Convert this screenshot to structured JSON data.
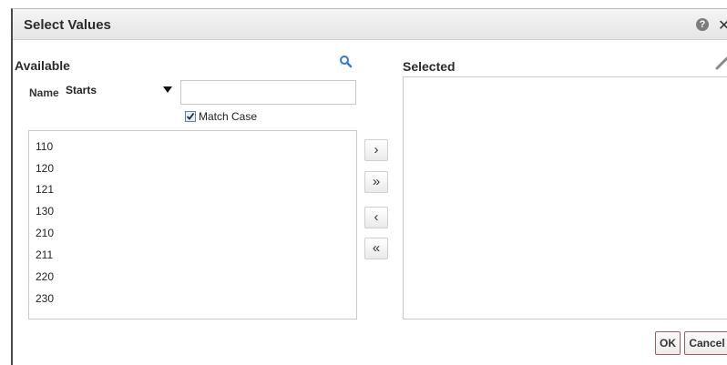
{
  "dialog": {
    "title": "Select Values",
    "help_symbol": "?",
    "close_symbol": "✕"
  },
  "available": {
    "heading": "Available",
    "filter": {
      "name_label": "Name",
      "operator_value": "Starts",
      "search_text": "",
      "match_case_label": "Match Case",
      "match_case_checked": true
    },
    "items": [
      "110",
      "120",
      "121",
      "130",
      "210",
      "211",
      "220",
      "230"
    ]
  },
  "shuttle": {
    "move_label": "›",
    "move_all_label": "»",
    "remove_label": "‹",
    "remove_all_label": "«"
  },
  "selected": {
    "heading": "Selected",
    "items": []
  },
  "footer": {
    "ok_label": "OK",
    "cancel_label": "Cancel"
  },
  "colors": {
    "icon_blue": "#2e7bcf",
    "button_border": "#a05a5a"
  },
  "icons": {
    "search": "search-icon",
    "edit": "pencil-icon",
    "help": "help-icon",
    "close": "close-icon"
  }
}
